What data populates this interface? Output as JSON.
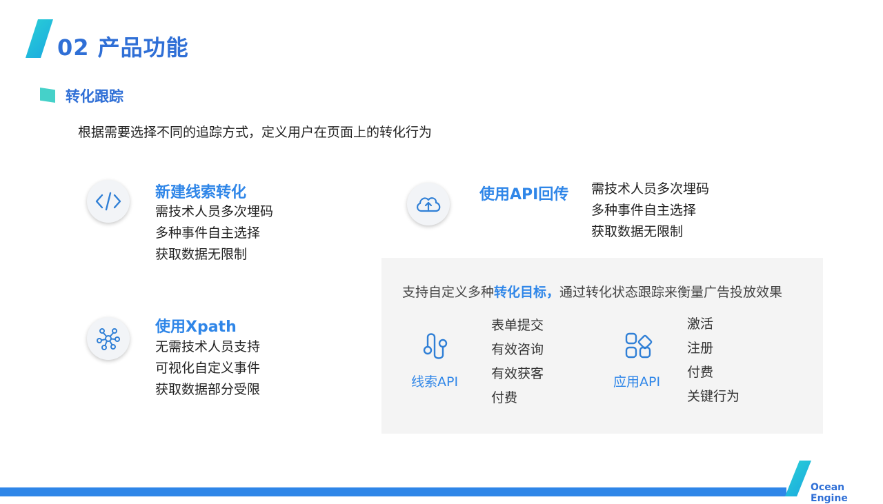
{
  "header": {
    "title": "02 产品功能"
  },
  "section": {
    "title": "转化跟踪",
    "intro": "根据需要选择不同的追踪方式，定义用户在页面上的转化行为"
  },
  "features": [
    {
      "title": "新建线索转化",
      "icon": "code-icon",
      "lines": [
        "需技术人员多次埋码",
        "多种事件自主选择",
        "获取数据无限制"
      ]
    },
    {
      "title": "使用API回传",
      "icon": "cloud-upload-icon",
      "lines": [
        "需技术人员多次埋码",
        "多种事件自主选择",
        "获取数据无限制"
      ]
    },
    {
      "title": "使用Xpath",
      "icon": "network-icon",
      "lines": [
        "无需技术人员支持",
        "可视化自定义事件",
        "获取数据部分受限"
      ]
    }
  ],
  "panel": {
    "head_pre": "支持自定义多种",
    "head_hl": "转化目标，",
    "head_post": "通过转化状态跟踪来衡量广告投放效果",
    "apis": [
      {
        "label": "线索API",
        "icon": "path-icon",
        "items": [
          "表单提交",
          "有效咨询",
          "有效获客",
          "付费"
        ]
      },
      {
        "label": "应用API",
        "icon": "apps-icon",
        "items": [
          "激活",
          "注册",
          "付费",
          "关键行为"
        ]
      }
    ]
  },
  "footer": {
    "brand": "Ocean Engine"
  },
  "colors": {
    "accent": "#2f86e8",
    "title": "#2f6fd6",
    "teal": "#45d1c9",
    "panel_bg": "#f4f4f4"
  }
}
